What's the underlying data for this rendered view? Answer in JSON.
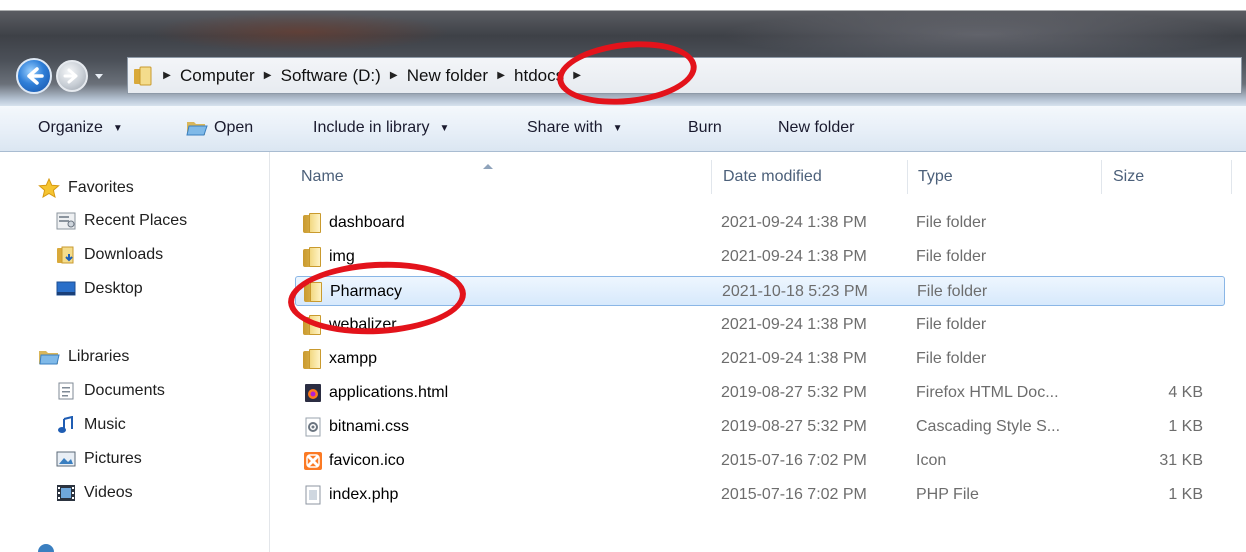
{
  "address": {
    "breadcrumbs": [
      "Computer",
      "Software (D:)",
      "New folder",
      "htdocs"
    ]
  },
  "toolbar": {
    "organize_label": "Organize",
    "open_label": "Open",
    "include_label": "Include in library",
    "share_label": "Share with",
    "burn_label": "Burn",
    "newfolder_label": "New folder"
  },
  "navpane": {
    "favorites_label": "Favorites",
    "favorites": [
      {
        "label": "Recent Places",
        "icon": "recent-places-icon"
      },
      {
        "label": "Downloads",
        "icon": "downloads-folder-icon"
      },
      {
        "label": "Desktop",
        "icon": "desktop-icon"
      }
    ],
    "libraries_label": "Libraries",
    "libraries": [
      {
        "label": "Documents",
        "icon": "documents-icon"
      },
      {
        "label": "Music",
        "icon": "music-icon"
      },
      {
        "label": "Pictures",
        "icon": "pictures-icon"
      },
      {
        "label": "Videos",
        "icon": "videos-icon"
      }
    ]
  },
  "columns": {
    "name": "Name",
    "date": "Date modified",
    "type": "Type",
    "size": "Size"
  },
  "files": [
    {
      "name": "dashboard",
      "date": "2021-09-24 1:38 PM",
      "type": "File folder",
      "size": "",
      "icon": "folder-icon"
    },
    {
      "name": "img",
      "date": "2021-09-24 1:38 PM",
      "type": "File folder",
      "size": "",
      "icon": "folder-icon"
    },
    {
      "name": "Pharmacy",
      "date": "2021-10-18 5:23 PM",
      "type": "File folder",
      "size": "",
      "icon": "folder-icon",
      "selected": true
    },
    {
      "name": "webalizer",
      "date": "2021-09-24 1:38 PM",
      "type": "File folder",
      "size": "",
      "icon": "folder-icon"
    },
    {
      "name": "xampp",
      "date": "2021-09-24 1:38 PM",
      "type": "File folder",
      "size": "",
      "icon": "folder-icon"
    },
    {
      "name": "applications.html",
      "date": "2019-08-27 5:32 PM",
      "type": "Firefox HTML Doc...",
      "size": "4 KB",
      "icon": "firefox-html-icon"
    },
    {
      "name": "bitnami.css",
      "date": "2019-08-27 5:32 PM",
      "type": "Cascading Style S...",
      "size": "1 KB",
      "icon": "css-file-icon"
    },
    {
      "name": "favicon.ico",
      "date": "2015-07-16 7:02 PM",
      "type": "Icon",
      "size": "31 KB",
      "icon": "xampp-icon"
    },
    {
      "name": "index.php",
      "date": "2015-07-16 7:02 PM",
      "type": "PHP File",
      "size": "1 KB",
      "icon": "php-file-icon"
    }
  ],
  "colors": {
    "annotation": "#e3131b",
    "selection_border": "#8ab6e6"
  }
}
